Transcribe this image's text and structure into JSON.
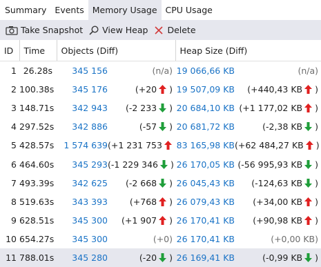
{
  "tabs": [
    "Summary",
    "Events",
    "Memory Usage",
    "CPU Usage"
  ],
  "active_tab": 2,
  "toolbar": {
    "snapshot_label": "Take Snapshot",
    "view_heap_label": "View Heap",
    "delete_label": "Delete"
  },
  "columns": {
    "id": "ID",
    "time": "Time",
    "objects": "Objects (Diff)",
    "heap": "Heap Size (Diff)"
  },
  "colors": {
    "link": "#1a73c6",
    "arrow_up": "#e02020",
    "arrow_down": "#1f9e3a",
    "selected_row": "#e6e7ee"
  },
  "rows": [
    {
      "id": "1",
      "time": "26.28s",
      "objects": "345 156",
      "objects_diff": "(n/a)",
      "objects_dir": "na",
      "heap": "19 066,66 KB",
      "heap_diff": "(n/a)",
      "heap_dir": "na"
    },
    {
      "id": "2",
      "time": "100.38s",
      "objects": "345 176",
      "objects_diff": "(+20",
      "objects_dir": "up",
      "heap": "19 507,09 KB",
      "heap_diff": "(+440,43 KB",
      "heap_dir": "up"
    },
    {
      "id": "3",
      "time": "148.71s",
      "objects": "342 943",
      "objects_diff": "(-2 233",
      "objects_dir": "down",
      "heap": "20 684,10 KB",
      "heap_diff": "(+1 177,02 KB",
      "heap_dir": "up"
    },
    {
      "id": "4",
      "time": "297.52s",
      "objects": "342 886",
      "objects_diff": "(-57",
      "objects_dir": "down",
      "heap": "20 681,72 KB",
      "heap_diff": "(-2,38 KB",
      "heap_dir": "down"
    },
    {
      "id": "5",
      "time": "428.57s",
      "objects": "1 574 639",
      "objects_diff": "(+1 231 753",
      "objects_dir": "up",
      "heap": "83 165,98 KB",
      "heap_diff": "(+62 484,27 KB",
      "heap_dir": "up"
    },
    {
      "id": "6",
      "time": "464.60s",
      "objects": "345 293",
      "objects_diff": "(-1 229 346",
      "objects_dir": "down",
      "heap": "26 170,05 KB",
      "heap_diff": "(-56 995,93 KB",
      "heap_dir": "down"
    },
    {
      "id": "7",
      "time": "493.39s",
      "objects": "342 625",
      "objects_diff": "(-2 668",
      "objects_dir": "down",
      "heap": "26 045,43 KB",
      "heap_diff": "(-124,63 KB",
      "heap_dir": "down"
    },
    {
      "id": "8",
      "time": "519.63s",
      "objects": "343 393",
      "objects_diff": "(+768",
      "objects_dir": "up",
      "heap": "26 079,43 KB",
      "heap_diff": "(+34,00 KB",
      "heap_dir": "up"
    },
    {
      "id": "9",
      "time": "628.51s",
      "objects": "345 300",
      "objects_diff": "(+1 907",
      "objects_dir": "up",
      "heap": "26 170,41 KB",
      "heap_diff": "(+90,98 KB",
      "heap_dir": "up"
    },
    {
      "id": "10",
      "time": "654.27s",
      "objects": "345 300",
      "objects_diff": "(+0)",
      "objects_dir": "zero",
      "heap": "26 170,41 KB",
      "heap_diff": "(+0,00 KB)",
      "heap_dir": "zero"
    },
    {
      "id": "11",
      "time": "788.01s",
      "objects": "345 280",
      "objects_diff": "(-20",
      "objects_dir": "down",
      "heap": "26 169,41 KB",
      "heap_diff": "(-0,99 KB",
      "heap_dir": "down"
    }
  ],
  "selected_row": 10
}
